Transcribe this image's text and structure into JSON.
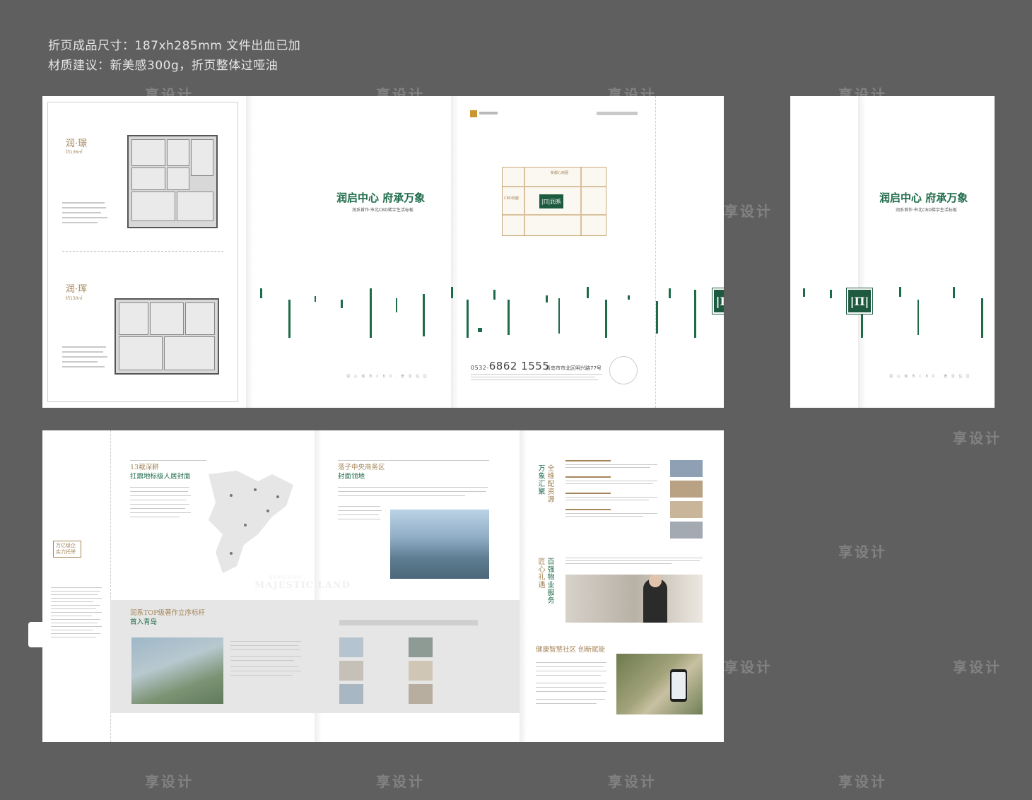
{
  "spec": {
    "line1": "折页成品尺寸：187xh285mm    文件出血已加",
    "line2": "材质建议：新美感300g，折页整体过哑油"
  },
  "floorplans": {
    "plan1_title": "润·璟",
    "plan2_title": "润·珲"
  },
  "cover": {
    "title": "润启中心 府承万象",
    "subtitle": "润系首作·市北CBD稀宇生活标板",
    "logo_glyph": "|П|",
    "footer": "润 心 城 市 C B D · 奢 享 住 区"
  },
  "back": {
    "map_center": "|П|润系",
    "map_left_label": "CBD商圈",
    "map_top_label": "新都心商圈",
    "phone_prefix": "0532-",
    "phone_number": "6862 1555",
    "address": "青岛市市北区明兴路77号"
  },
  "inside": {
    "s1_title": "13载深耕",
    "s1_sub": "扛鼎地标级人居封面",
    "s2_title": "落子中央商务区",
    "s2_sub": "封面领地",
    "s3_title": "润系TOP级著作立序标杆",
    "s3_sub": "首入青岛",
    "s4_vert_a": "万象汇聚",
    "s4_vert_b": "全维配资源",
    "s5_vert_a": "匠心礼遇",
    "s5_vert_b": "百强物业服务",
    "s6_title": "健康智慧社区 创新赋能",
    "majestic": "MAJESTIC LAND",
    "qingdao": "QINGDAO",
    "tag": "万亿级企 实力托举"
  }
}
